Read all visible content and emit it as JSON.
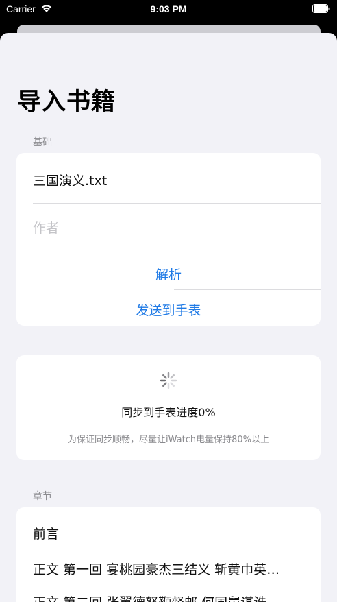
{
  "status_bar": {
    "carrier": "Carrier",
    "time": "9:03 PM"
  },
  "page": {
    "title": "导入书籍"
  },
  "basic": {
    "header": "基础",
    "file_name": "三国演义.txt",
    "author_placeholder": "作者",
    "parse_label": "解析",
    "send_label": "发送到手表"
  },
  "sync": {
    "progress_text": "同步到手表进度0%",
    "progress_percent": 0,
    "hint": "为保证同步顺畅，尽量让iWatch电量保持80%以上"
  },
  "chapters": {
    "header": "章节",
    "items": [
      "前言",
      "正文 第一回 宴桃园豪杰三结义 斩黄巾英…",
      "正文 第二回 张翼德怒鞭督邮 何国舅谋诛…"
    ]
  },
  "colors": {
    "accent": "#1f7ae6",
    "background": "#f2f2f7",
    "card": "#ffffff",
    "secondary_text": "#8a8a8e"
  }
}
